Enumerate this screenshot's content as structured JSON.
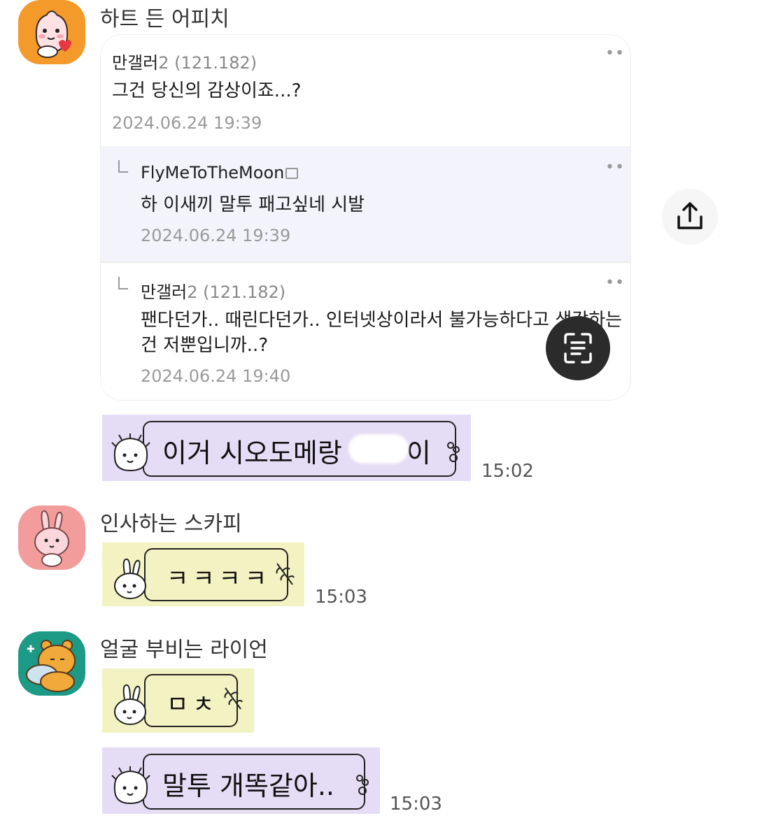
{
  "messages": [
    {
      "sender": "하트 든 어피치",
      "avatar_icon": "apeach-heart-icon",
      "quote": {
        "comments": [
          {
            "author": "만갤러",
            "author_suffix": "2 (121.182)",
            "text": "그건 당신의 감상이죠...?",
            "date": "2024.06.24 19:39"
          },
          {
            "author": "FlyMeToTheMoon",
            "author_suffix": "",
            "text": "하 이새끼 말투 패고싶네 시발",
            "date": "2024.06.24 19:39",
            "is_reply": true
          },
          {
            "author": "만갤러",
            "author_suffix": "2 (121.182)",
            "text": "팬다던가.. 때린다던가.. 인터넷상이라서 불가능하다고 생각하는건 저뿐입니까..?",
            "date": "2024.06.24 19:40",
            "is_reply": true
          }
        ],
        "more_icon": "more-dots-icon"
      },
      "emoticon": {
        "text_before": "이거 시오도메랑",
        "text_after": "이",
        "color": "#e5dcf5"
      },
      "time": "15:02"
    },
    {
      "sender": "인사하는 스카피",
      "avatar_icon": "scappy-bunny-icon",
      "emoticon": {
        "text": "ㅋㅋㅋㅋ",
        "color": "#f3f2c2"
      },
      "time": "15:03"
    },
    {
      "sender": "얼굴 부비는 라이언",
      "avatar_icon": "ryan-hug-icon",
      "emoticons": [
        {
          "text": "ㅁㅊ",
          "color": "#f3f2c2"
        },
        {
          "text": "말투 개똑같아..",
          "color": "#e5dcf5"
        }
      ],
      "time": "15:03"
    }
  ],
  "overlay": {
    "share_icon": "share-upload-icon",
    "scan_icon": "text-scan-icon"
  }
}
